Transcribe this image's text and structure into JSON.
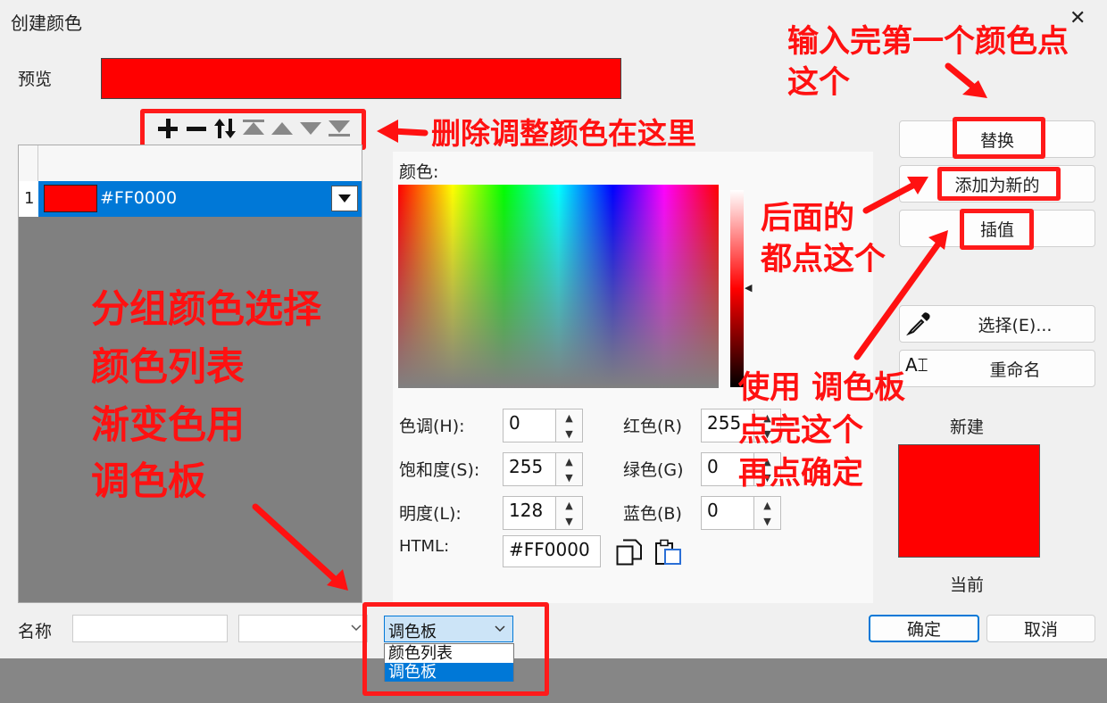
{
  "window": {
    "title": "创建颜色",
    "close_label": "✕"
  },
  "preview": {
    "label": "预览",
    "color": "#ff0000"
  },
  "list": {
    "rows": [
      {
        "index": "1",
        "swatch": "#ff0000",
        "value": "#FF0000"
      }
    ]
  },
  "picker": {
    "label": "颜色:"
  },
  "fields": {
    "hue_label": "色调(H):",
    "hue": "0",
    "sat_label": "饱和度(S):",
    "sat": "255",
    "lum_label": "明度(L):",
    "lum": "128",
    "red_label": "红色(R)",
    "red": "255",
    "green_label": "绿色(G)",
    "green": "0",
    "blue_label": "蓝色(B)",
    "blue": "0",
    "html_label": "HTML:",
    "html": "#FF0000"
  },
  "right_buttons": {
    "replace": "替换",
    "add_new": "添加为新的",
    "interpolate": "插值",
    "select": "选择(E)...",
    "rename": "重命名"
  },
  "swatch_panel": {
    "new_label": "新建",
    "current_label": "当前",
    "color": "#ff0000"
  },
  "bottom": {
    "name_label": "名称",
    "name_value": "",
    "mode_selected": "调色板",
    "mode_options": [
      "颜色列表",
      "调色板"
    ],
    "ok": "确定",
    "cancel": "取消"
  },
  "annotations": {
    "top_right_1": "输入完第一个颜色点",
    "top_right_2": "这个",
    "toolbar": "删除调整颜色在这里",
    "later_1": "后面的",
    "later_2": "都点这个",
    "left_1": "分组颜色选择",
    "left_2": "颜色列表",
    "left_3": "渐变色用",
    "left_4": "调色板",
    "palette_1": "使用 调色板",
    "palette_2": "点完这个",
    "palette_3": "再点确定"
  }
}
